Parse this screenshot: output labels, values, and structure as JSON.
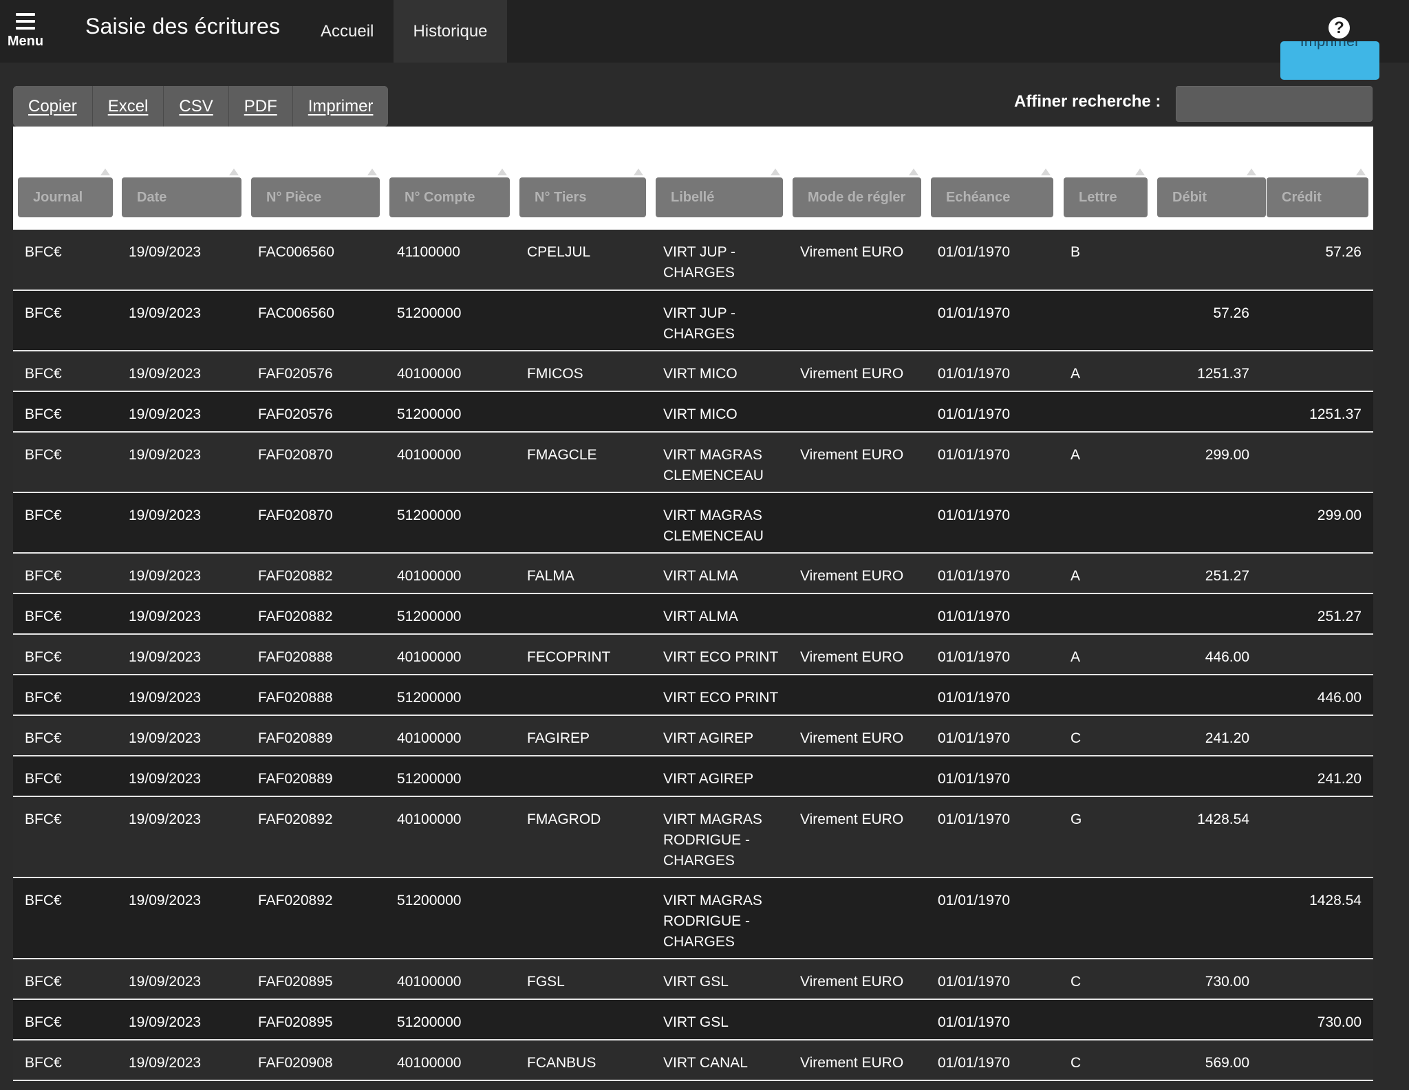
{
  "topbar": {
    "menu_label": "Menu",
    "app_title": "Saisie des écritures",
    "nav": [
      "Accueil",
      "Historique"
    ]
  },
  "print_button_label": "Imprimer",
  "export_buttons": [
    "Copier",
    "Excel",
    "CSV",
    "PDF",
    "Imprimer"
  ],
  "search": {
    "label": "Affiner recherche :",
    "value": ""
  },
  "columns": [
    "Journal",
    "Date",
    "N° Pièce",
    "N° Compte",
    "N° Tiers",
    "Libellé",
    "Mode de régler",
    "Echéance",
    "Lettre",
    "Débit",
    "Crédit"
  ],
  "rows": [
    {
      "journal": "BFC€",
      "date": "19/09/2023",
      "piece": "FAC006560",
      "compte": "41100000",
      "tiers": "CPELJUL",
      "libelle": "VIRT JUP -\nCHARGES",
      "mode": "Virement EURO",
      "echeance": "01/01/1970",
      "lettre": "B",
      "debit": "",
      "credit": "57.26"
    },
    {
      "journal": "BFC€",
      "date": "19/09/2023",
      "piece": "FAC006560",
      "compte": "51200000",
      "tiers": "",
      "libelle": "VIRT JUP -\nCHARGES",
      "mode": "",
      "echeance": "01/01/1970",
      "lettre": "",
      "debit": "57.26",
      "credit": ""
    },
    {
      "journal": "BFC€",
      "date": "19/09/2023",
      "piece": "FAF020576",
      "compte": "40100000",
      "tiers": "FMICOS",
      "libelle": "VIRT MICO",
      "mode": "Virement EURO",
      "echeance": "01/01/1970",
      "lettre": "A",
      "debit": "1251.37",
      "credit": ""
    },
    {
      "journal": "BFC€",
      "date": "19/09/2023",
      "piece": "FAF020576",
      "compte": "51200000",
      "tiers": "",
      "libelle": "VIRT MICO",
      "mode": "",
      "echeance": "01/01/1970",
      "lettre": "",
      "debit": "",
      "credit": "1251.37"
    },
    {
      "journal": "BFC€",
      "date": "19/09/2023",
      "piece": "FAF020870",
      "compte": "40100000",
      "tiers": "FMAGCLE",
      "libelle": "VIRT MAGRAS\nCLEMENCEAU",
      "mode": "Virement EURO",
      "echeance": "01/01/1970",
      "lettre": "A",
      "debit": "299.00",
      "credit": ""
    },
    {
      "journal": "BFC€",
      "date": "19/09/2023",
      "piece": "FAF020870",
      "compte": "51200000",
      "tiers": "",
      "libelle": "VIRT MAGRAS\nCLEMENCEAU",
      "mode": "",
      "echeance": "01/01/1970",
      "lettre": "",
      "debit": "",
      "credit": "299.00"
    },
    {
      "journal": "BFC€",
      "date": "19/09/2023",
      "piece": "FAF020882",
      "compte": "40100000",
      "tiers": "FALMA",
      "libelle": "VIRT ALMA",
      "mode": "Virement EURO",
      "echeance": "01/01/1970",
      "lettre": "A",
      "debit": "251.27",
      "credit": ""
    },
    {
      "journal": "BFC€",
      "date": "19/09/2023",
      "piece": "FAF020882",
      "compte": "51200000",
      "tiers": "",
      "libelle": "VIRT ALMA",
      "mode": "",
      "echeance": "01/01/1970",
      "lettre": "",
      "debit": "",
      "credit": "251.27"
    },
    {
      "journal": "BFC€",
      "date": "19/09/2023",
      "piece": "FAF020888",
      "compte": "40100000",
      "tiers": "FECOPRINT",
      "libelle": "VIRT ECO PRINT",
      "mode": "Virement EURO",
      "echeance": "01/01/1970",
      "lettre": "A",
      "debit": "446.00",
      "credit": ""
    },
    {
      "journal": "BFC€",
      "date": "19/09/2023",
      "piece": "FAF020888",
      "compte": "51200000",
      "tiers": "",
      "libelle": "VIRT ECO PRINT",
      "mode": "",
      "echeance": "01/01/1970",
      "lettre": "",
      "debit": "",
      "credit": "446.00"
    },
    {
      "journal": "BFC€",
      "date": "19/09/2023",
      "piece": "FAF020889",
      "compte": "40100000",
      "tiers": "FAGIREP",
      "libelle": "VIRT AGIREP",
      "mode": "Virement EURO",
      "echeance": "01/01/1970",
      "lettre": "C",
      "debit": "241.20",
      "credit": ""
    },
    {
      "journal": "BFC€",
      "date": "19/09/2023",
      "piece": "FAF020889",
      "compte": "51200000",
      "tiers": "",
      "libelle": "VIRT AGIREP",
      "mode": "",
      "echeance": "01/01/1970",
      "lettre": "",
      "debit": "",
      "credit": "241.20"
    },
    {
      "journal": "BFC€",
      "date": "19/09/2023",
      "piece": "FAF020892",
      "compte": "40100000",
      "tiers": "FMAGROD",
      "libelle": "VIRT MAGRAS\nRODRIGUE -\nCHARGES",
      "mode": "Virement EURO",
      "echeance": "01/01/1970",
      "lettre": "G",
      "debit": "1428.54",
      "credit": ""
    },
    {
      "journal": "BFC€",
      "date": "19/09/2023",
      "piece": "FAF020892",
      "compte": "51200000",
      "tiers": "",
      "libelle": "VIRT MAGRAS\nRODRIGUE -\nCHARGES",
      "mode": "",
      "echeance": "01/01/1970",
      "lettre": "",
      "debit": "",
      "credit": "1428.54"
    },
    {
      "journal": "BFC€",
      "date": "19/09/2023",
      "piece": "FAF020895",
      "compte": "40100000",
      "tiers": "FGSL",
      "libelle": "VIRT GSL",
      "mode": "Virement EURO",
      "echeance": "01/01/1970",
      "lettre": "C",
      "debit": "730.00",
      "credit": ""
    },
    {
      "journal": "BFC€",
      "date": "19/09/2023",
      "piece": "FAF020895",
      "compte": "51200000",
      "tiers": "",
      "libelle": "VIRT GSL",
      "mode": "",
      "echeance": "01/01/1970",
      "lettre": "",
      "debit": "",
      "credit": "730.00"
    },
    {
      "journal": "BFC€",
      "date": "19/09/2023",
      "piece": "FAF020908",
      "compte": "40100000",
      "tiers": "FCANBUS",
      "libelle": "VIRT CANAL",
      "mode": "Virement EURO",
      "echeance": "01/01/1970",
      "lettre": "C",
      "debit": "569.00",
      "credit": ""
    }
  ]
}
